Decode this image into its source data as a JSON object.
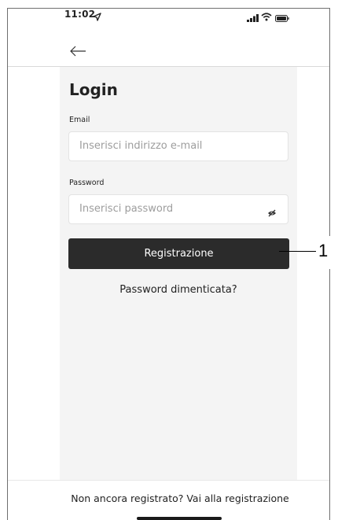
{
  "status_bar": {
    "time": "11:02"
  },
  "login": {
    "title": "Login",
    "email_label": "Email",
    "email_placeholder": "Inserisci indirizzo e-mail",
    "password_label": "Password",
    "password_placeholder": "Inserisci password",
    "register_button": "Registrazione",
    "forgot_password": "Password dimenticata?"
  },
  "footer": {
    "register_link": "Non ancora registrato? Vai alla registrazione"
  },
  "callout": {
    "number": "1"
  },
  "icons": {
    "location": "location-arrow-icon",
    "signal": "cellular-signal-icon",
    "wifi": "wifi-icon",
    "battery": "battery-icon",
    "back": "back-arrow-icon",
    "password_toggle": "eye-off-icon"
  },
  "colors": {
    "primary_button": "#2b2b2b",
    "content_background": "#f4f4f4",
    "placeholder": "#9d9d9d"
  }
}
